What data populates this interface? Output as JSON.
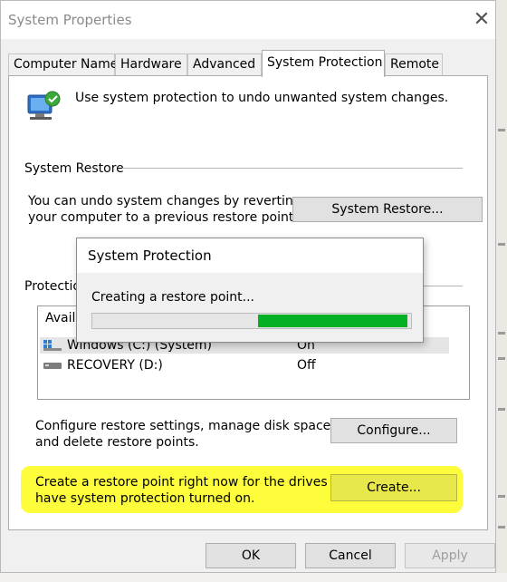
{
  "window": {
    "title": "System Properties",
    "close_glyph": "✕"
  },
  "tabs": [
    {
      "label": "Computer Name",
      "active": false
    },
    {
      "label": "Hardware",
      "active": false
    },
    {
      "label": "Advanced",
      "active": false
    },
    {
      "label": "System Protection",
      "active": true
    },
    {
      "label": "Remote",
      "active": false
    }
  ],
  "intro": "Use system protection to undo unwanted system changes.",
  "system_restore": {
    "group_label": "System Restore",
    "desc_line1": "You can undo system changes by reverting",
    "desc_line2": "your computer to a previous restore point.",
    "button": "System Restore..."
  },
  "protection": {
    "group_label_partial": "Protection",
    "list_header_partial": "Availa",
    "drives": [
      {
        "name": "Windows (C:) (System)",
        "status": "On",
        "icon": "windows-drive-icon"
      },
      {
        "name": "RECOVERY (D:)",
        "status": "Off",
        "icon": "drive-icon"
      }
    ]
  },
  "configure": {
    "desc_line1": "Configure restore settings, manage disk space,",
    "desc_line2": "and delete restore points.",
    "button": "Configure..."
  },
  "create": {
    "desc_line1": "Create a restore point right now for the drives that",
    "desc_line2": "have system protection turned on.",
    "button": "Create...",
    "highlight_color": "#fdfd3c"
  },
  "footer": {
    "ok": "OK",
    "cancel": "Cancel",
    "apply": "Apply"
  },
  "progress_dialog": {
    "title": "System Protection",
    "message": "Creating a restore point...",
    "progress": {
      "start": 0.52,
      "end": 0.99,
      "color": "#06b025"
    }
  }
}
